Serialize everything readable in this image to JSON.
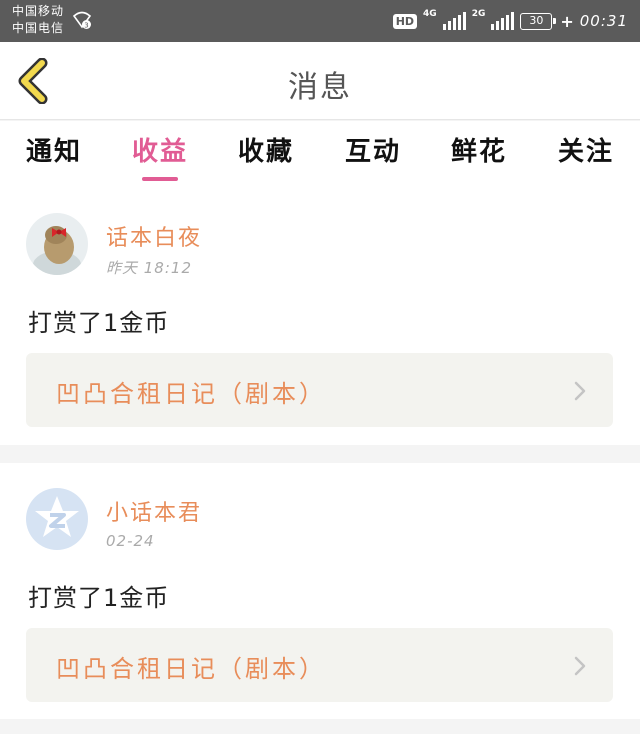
{
  "status_bar": {
    "carrier_1": "中国移动",
    "carrier_2": "中国电信",
    "hd": "HD",
    "net_1": "4G",
    "net_2": "2G",
    "battery": "30",
    "time": "00:31"
  },
  "header": {
    "title": "消息"
  },
  "tabs": [
    {
      "label": "通知"
    },
    {
      "label": "收益"
    },
    {
      "label": "收藏"
    },
    {
      "label": "互动"
    },
    {
      "label": "鲜花"
    },
    {
      "label": "关注"
    }
  ],
  "active_tab": "收益",
  "messages": [
    {
      "user": "话本白夜",
      "time": "昨天 18:12",
      "text": "打赏了1金币",
      "work": "凹凸合租日记（剧本）"
    },
    {
      "user": "小话本君",
      "time": "02-24",
      "text": "打赏了1金币",
      "work": "凹凸合租日记（剧本）"
    }
  ],
  "colors": {
    "accent": "#e15c94",
    "name": "#e88d5a",
    "back_icon": "#f2d94e"
  }
}
